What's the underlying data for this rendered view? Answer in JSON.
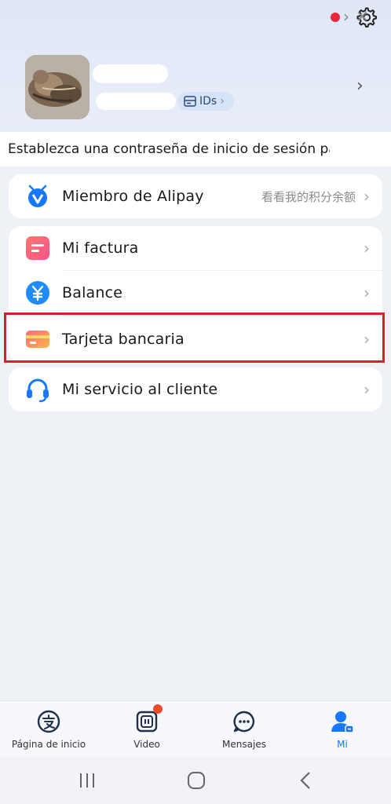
{
  "profile": {
    "ids_label": "IDs",
    "icons": {
      "settings": "gear-icon",
      "avatar": "cat-photo"
    }
  },
  "notice": {
    "text": "Establezca una contraseña de inicio de sesión pa..."
  },
  "member": {
    "label": "Miembro de Alipay",
    "hint": "看看我的积分余额"
  },
  "menu": {
    "factura": "Mi factura",
    "balance": "Balance",
    "tarjeta": "Tarjeta bancaria",
    "servicio": "Mi servicio al cliente"
  },
  "tabs": [
    {
      "label": "Página de inicio"
    },
    {
      "label": "Video"
    },
    {
      "label": "Mensajes"
    },
    {
      "label": "Mi"
    }
  ],
  "colors": {
    "accent": "#1677ff",
    "highlight": "#d5202e",
    "badge": "#ee4b2b"
  }
}
